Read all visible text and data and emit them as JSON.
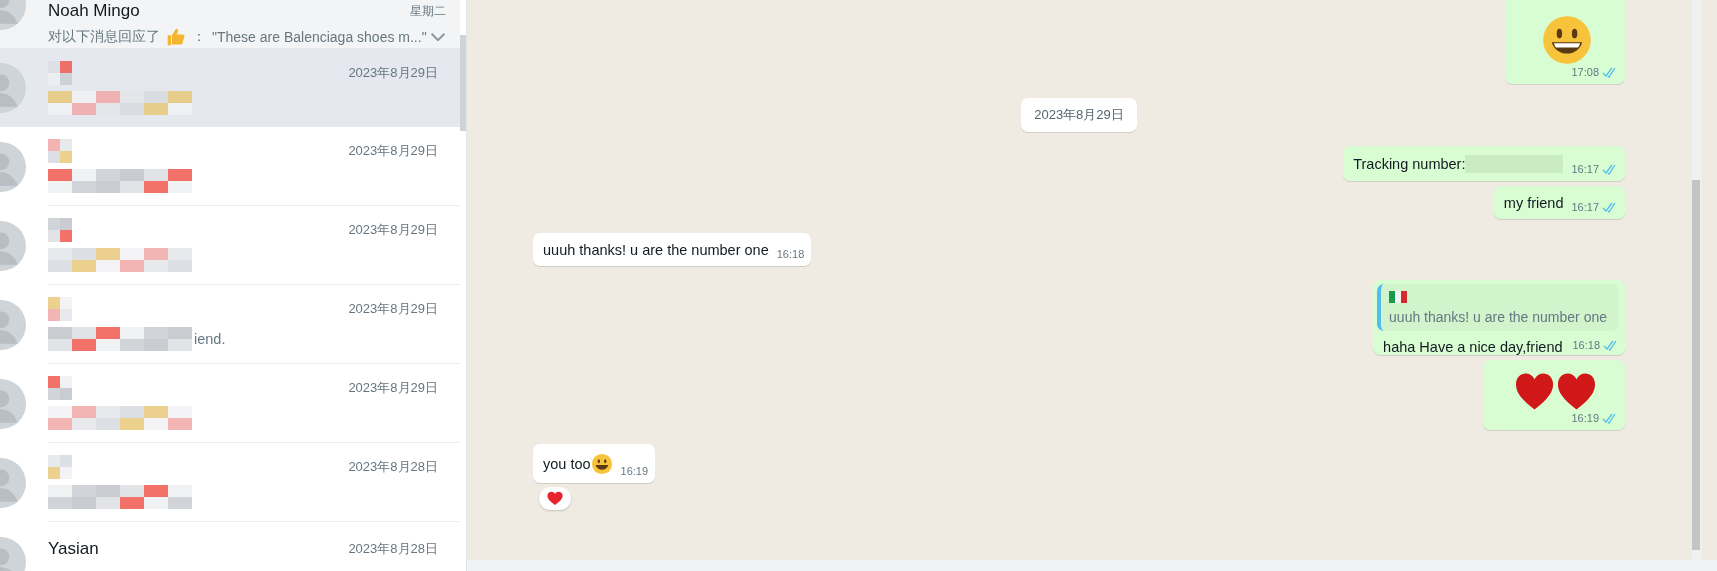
{
  "chats": [
    {
      "name": "Noah Mingo",
      "date": "星期二",
      "reaction_prefix": "对以下消息回应了",
      "reaction_sep": "：",
      "preview": "\"These are Balenciaga shoes m...\"",
      "selected": false,
      "hovered": true
    },
    {
      "date": "2023年8月29日",
      "selected": true,
      "hovered": false
    },
    {
      "date": "2023年8月29日",
      "selected": false,
      "hovered": false
    },
    {
      "date": "2023年8月29日",
      "selected": false,
      "hovered": false
    },
    {
      "date": "2023年8月29日",
      "preview": "iend.",
      "selected": false,
      "hovered": false
    },
    {
      "date": "2023年8月29日",
      "selected": false,
      "hovered": false
    },
    {
      "date": "2023年8月28日",
      "selected": false,
      "hovered": false
    },
    {
      "name": "Yasian",
      "date": "2023年8月28日",
      "selected": false,
      "hovered": false
    }
  ],
  "messages": [
    {
      "kind": "big_smiley",
      "outgoing": true,
      "time": "17:08",
      "read": true
    },
    {
      "kind": "date",
      "text": "2023年8月29日"
    },
    {
      "kind": "text",
      "outgoing": true,
      "text": "Tracking number:",
      "redacted": true,
      "time": "16:17",
      "read": true
    },
    {
      "kind": "text",
      "outgoing": true,
      "text": "my friend",
      "time": "16:17",
      "read": true
    },
    {
      "kind": "text",
      "outgoing": false,
      "text": "uuuh thanks! u are the number one",
      "time": "16:18"
    },
    {
      "kind": "reply",
      "outgoing": true,
      "quote": "uuuh thanks! u are the number one",
      "text": "haha Have a nice day,friend",
      "time": "16:18",
      "read": true
    },
    {
      "kind": "big_hearts",
      "outgoing": true,
      "time": "16:19",
      "read": true
    },
    {
      "kind": "text",
      "outgoing": false,
      "text": "you too",
      "smiley_after": true,
      "time": "16:19",
      "reaction": true
    }
  ]
}
